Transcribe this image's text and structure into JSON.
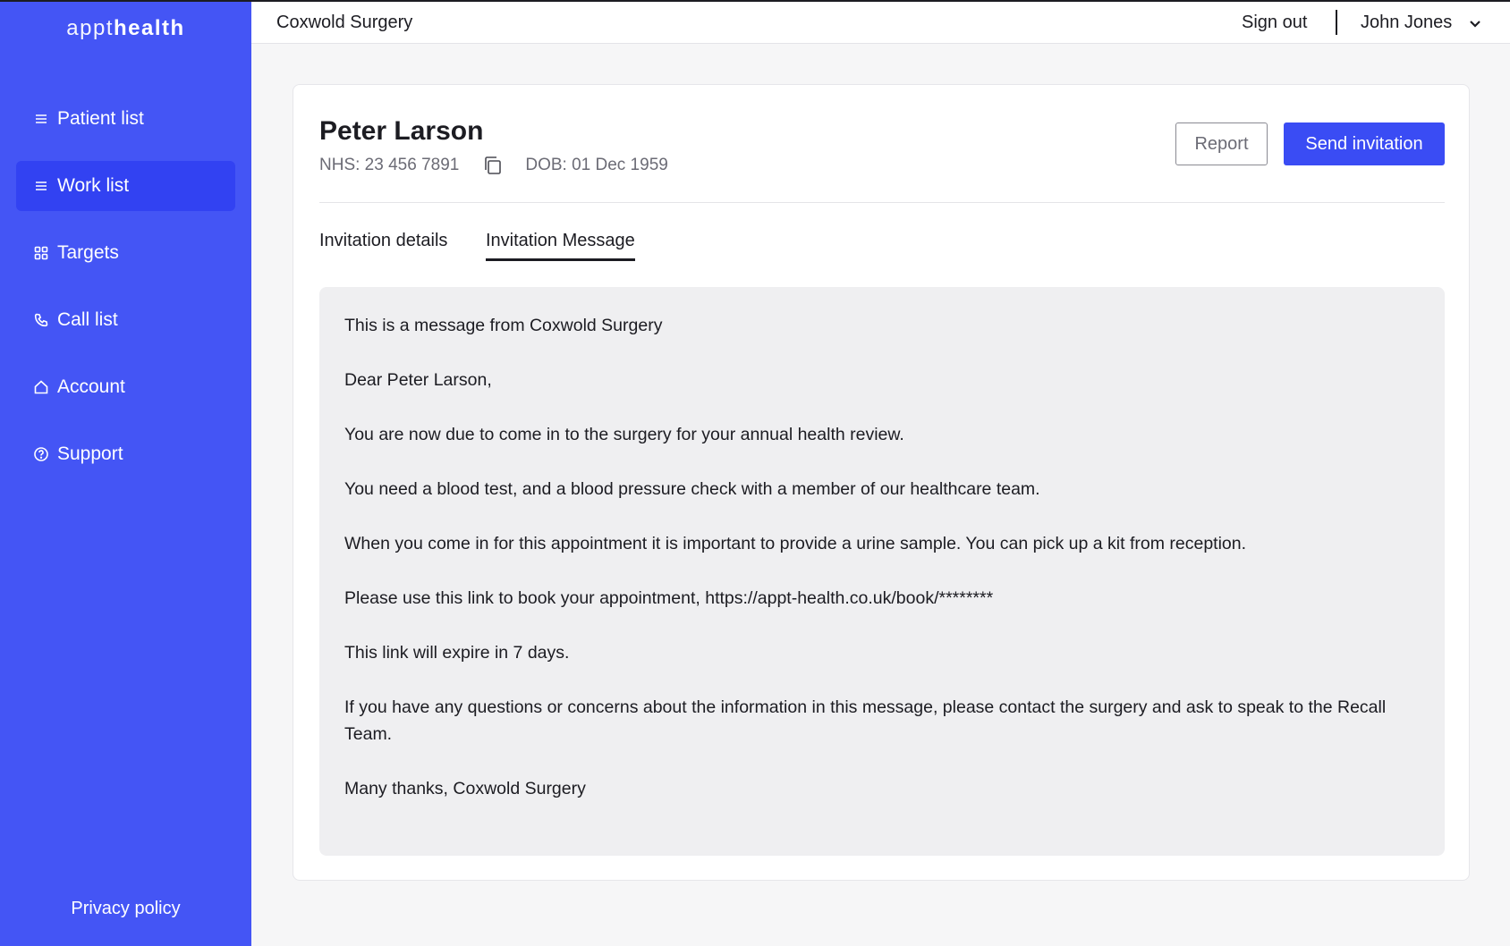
{
  "brand": {
    "light": "appt",
    "bold": "health"
  },
  "sidebar": {
    "items": [
      {
        "label": "Patient list",
        "icon": "menu-icon",
        "active": false
      },
      {
        "label": "Work list",
        "icon": "menu-icon",
        "active": true
      },
      {
        "label": "Targets",
        "icon": "grid-icon",
        "active": false
      },
      {
        "label": "Call list",
        "icon": "phone-icon",
        "active": false
      },
      {
        "label": "Account",
        "icon": "home-icon",
        "active": false
      },
      {
        "label": "Support",
        "icon": "help-circle-icon",
        "active": false
      }
    ],
    "privacy": "Privacy policy"
  },
  "topbar": {
    "practice": "Coxwold Surgery",
    "signout": "Sign out",
    "user": "John Jones"
  },
  "patient": {
    "name": "Peter Larson",
    "nhs": "NHS: 23 456 7891",
    "dob": "DOB: 01 Dec 1959"
  },
  "actions": {
    "report": "Report",
    "send": "Send invitation"
  },
  "tabs": [
    {
      "label": "Invitation details",
      "active": false
    },
    {
      "label": "Invitation Message",
      "active": true
    }
  ],
  "message": [
    "This is a message from Coxwold Surgery",
    "Dear Peter Larson,",
    "You are now due to come in to the surgery for your annual health review.",
    "You need a blood test, and a blood pressure check with a member of our healthcare team.",
    "When you come in for this appointment it is important to provide a urine sample. You can pick up a kit from reception.",
    "Please use this link to book your appointment, https://appt-health.co.uk/book/********",
    "This link will expire in 7 days.",
    "If you have any questions or concerns about the information in this message, please contact the surgery and ask to speak to the Recall Team.",
    "Many thanks, Coxwold Surgery"
  ],
  "colors": {
    "sidebar": "#4455f5",
    "active": "#3242f2",
    "primary": "#3a4cf4"
  }
}
